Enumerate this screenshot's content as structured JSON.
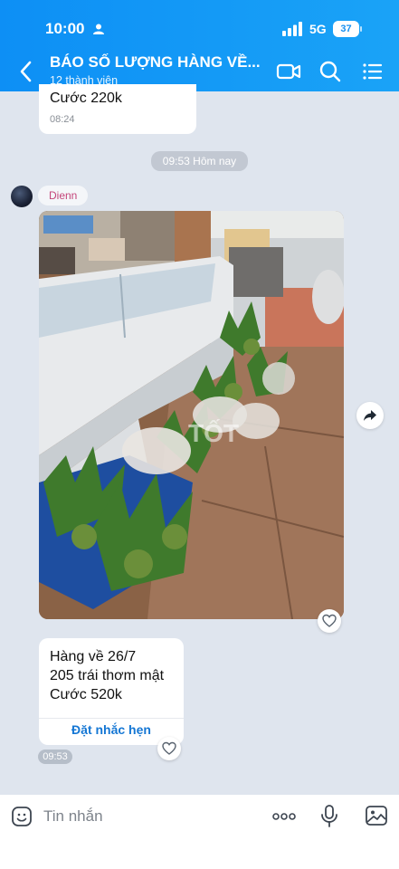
{
  "status_bar": {
    "time": "10:00",
    "network": "5G",
    "battery": "37"
  },
  "header": {
    "title": "BÁO SỐ LƯỢNG HÀNG VỀ...",
    "subtitle": "12 thành viên"
  },
  "previous_message": {
    "text": "Cước 220k",
    "time": "08:24"
  },
  "date_separator": "09:53 Hôm nay",
  "sender_name": "Dienn",
  "text_message": {
    "lines": [
      "Hàng về 26/7",
      "205 trái thơm mật",
      "Cước 520k"
    ],
    "remind_label": "Đặt nhắc hẹn",
    "time": "09:53"
  },
  "photo_watermark": "TỐT",
  "input": {
    "placeholder": "Tin nhắn"
  },
  "colors": {
    "header": "#1597f6",
    "background": "#dfe5ee",
    "link": "#1577d4",
    "sender": "#c4457a"
  },
  "icons": [
    "person-icon",
    "signal-icon",
    "back-icon",
    "video-call-icon",
    "search-icon",
    "menu-icon",
    "heart-icon",
    "share-icon",
    "emoji-icon",
    "more-icon",
    "mic-icon",
    "image-icon"
  ]
}
